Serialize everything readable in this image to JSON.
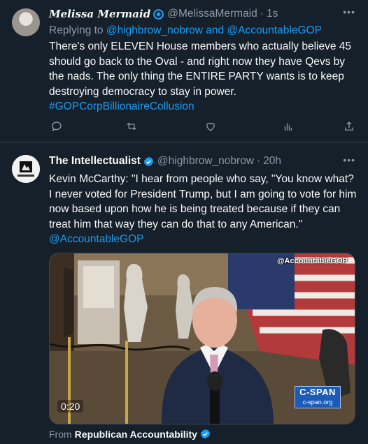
{
  "tweet1": {
    "display_name": "Melissa Mermaid",
    "handle": "@MelissaMermaid",
    "separator": "·",
    "time": "1s",
    "more_label": "•••",
    "replying_prefix": "Replying to",
    "replying_to": "@highbrow_nobrow and @AccountableGOP",
    "text": "There's only ELEVEN House members who actually believe 45 should go back to the Oval - and right now they have Qevs by the nads. The only thing the ENTIRE PARTY wants is to keep destroying democracy to stay in power.",
    "hashtag": "#GOPCorpBillionaireCollusion",
    "actions": [
      "reply-icon",
      "retweet-icon",
      "like-icon",
      "views-icon",
      "share-icon"
    ]
  },
  "tweet2": {
    "display_name": "The Intellectualist",
    "handle": "@highbrow_nobrow",
    "separator": "·",
    "time": "20h",
    "more_label": "•••",
    "text": "Kevin McCarthy: \"I hear from people who say, \"You know what? I never voted for President Trump, but I am going to vote for him now based upon how he is being treated because if they can treat him that way they can do that to any American.\"",
    "mention": "@AccountableGOP",
    "media": {
      "watermark": "@AccountableGOP",
      "duration": "0:20",
      "network_logo": "C-SPAN",
      "network_url": "c-span.org"
    },
    "from_label": "From",
    "from_account": "Republican Accountability"
  },
  "colors": {
    "background": "#15202b",
    "text": "#f7f9f9",
    "muted": "#8b98a5",
    "link": "#1d9bf0",
    "divider": "#38444d"
  }
}
